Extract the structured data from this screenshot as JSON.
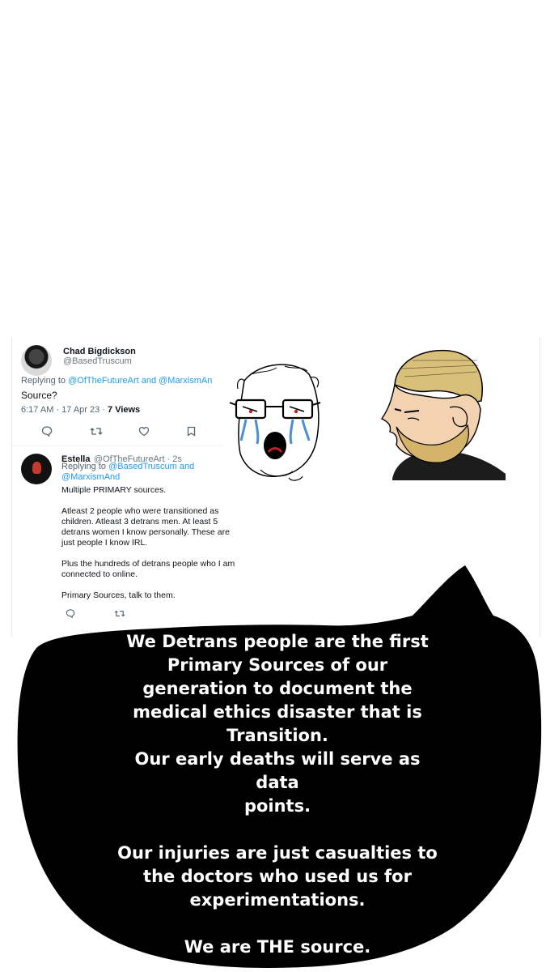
{
  "tweet1": {
    "name": "Chad Bigdickson",
    "handle": "@BasedTruscum",
    "replying_prefix": "Replying to ",
    "replying_links": "@OfTheFutureArt and @MarxismAn",
    "text": "Source?",
    "time": "6:17 AM · 17 Apr 23 · ",
    "views": "7 Views"
  },
  "tweet2": {
    "name": "Estella",
    "handle_time": "@OfTheFutureArt · 2s",
    "replying_prefix": "Replying to ",
    "replying_line1": "@BasedTruscum and",
    "replying_line2": "@MarxismAnd",
    "text": "Multiple PRIMARY sources.\n\nAtleast 2 people who were transitioned as\nchildren. Atleast 3 detrans men. At least 5\ndetrans women I know personally. These are\njust people I know IRL.\n\nPlus the hundreds of detrans people who I am\nconnected to online.\n\nPrimary Sources, talk to them."
  },
  "caption": "We Detrans people are the first\nPrimary Sources of our\ngeneration to document the\nmedical ethics disaster that is\nTransition.\nOur early deaths will serve as data\npoints.\n\nOur injuries are just casualties to\nthe doctors who used us for\nexperimentations.\n\nWe are THE source.",
  "icons": [
    "reply-icon",
    "retweet-icon",
    "like-icon",
    "bookmark-icon"
  ],
  "colors": {
    "link": "#1d9bf0",
    "muted": "#536471",
    "blob": "#000000",
    "caption": "#ffffff"
  }
}
